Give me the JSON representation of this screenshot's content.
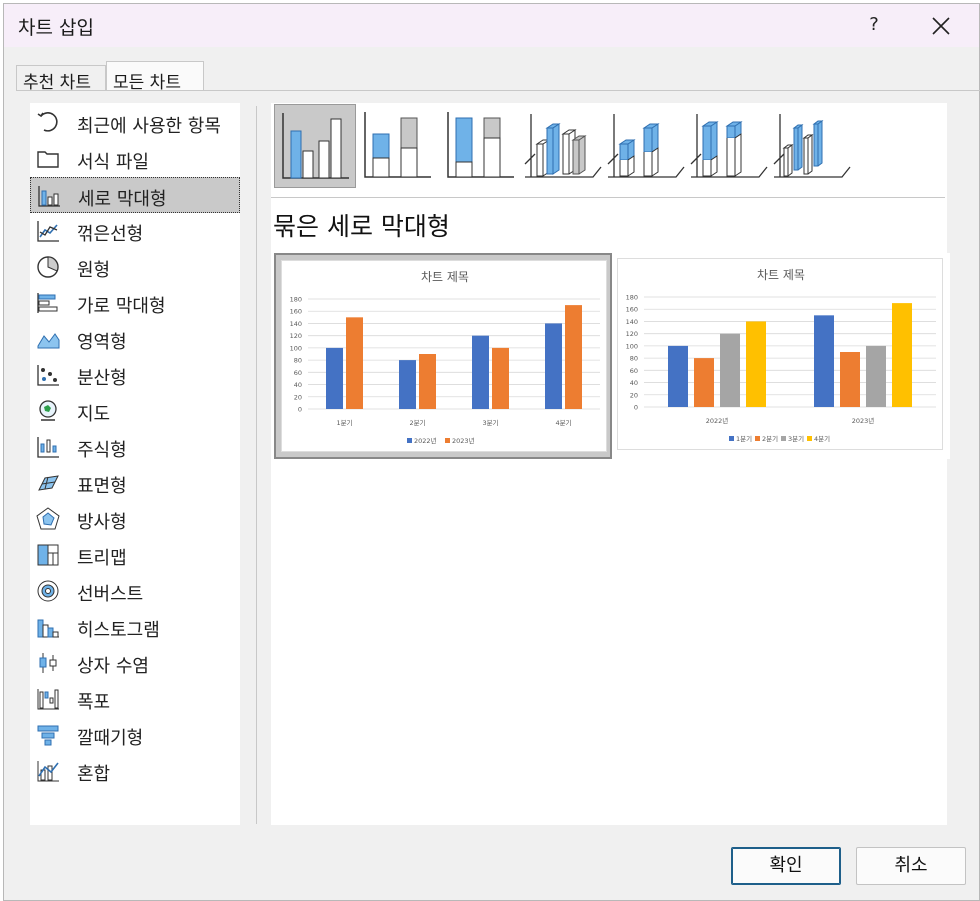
{
  "dialog": {
    "title": "차트 삽입",
    "help": "?",
    "tabs": [
      "추천 차트",
      "모든 차트"
    ]
  },
  "chart_types": [
    {
      "label": "최근에 사용한 항목",
      "icon": "recent-icon"
    },
    {
      "label": "서식 파일",
      "icon": "folder-icon"
    },
    {
      "label": "세로 막대형",
      "icon": "column-chart-icon",
      "selected": true
    },
    {
      "label": "꺾은선형",
      "icon": "line-chart-icon"
    },
    {
      "label": "원형",
      "icon": "pie-chart-icon"
    },
    {
      "label": "가로 막대형",
      "icon": "bar-chart-icon"
    },
    {
      "label": "영역형",
      "icon": "area-chart-icon"
    },
    {
      "label": "분산형",
      "icon": "scatter-chart-icon"
    },
    {
      "label": "지도",
      "icon": "map-chart-icon"
    },
    {
      "label": "주식형",
      "icon": "stock-chart-icon"
    },
    {
      "label": "표면형",
      "icon": "surface-chart-icon"
    },
    {
      "label": "방사형",
      "icon": "radar-chart-icon"
    },
    {
      "label": "트리맵",
      "icon": "treemap-icon"
    },
    {
      "label": "선버스트",
      "icon": "sunburst-icon"
    },
    {
      "label": "히스토그램",
      "icon": "histogram-icon"
    },
    {
      "label": "상자 수염",
      "icon": "box-whisker-icon"
    },
    {
      "label": "폭포",
      "icon": "waterfall-icon"
    },
    {
      "label": "깔때기형",
      "icon": "funnel-icon"
    },
    {
      "label": "혼합",
      "icon": "combo-chart-icon"
    }
  ],
  "subtype_title": "묶은 세로 막대형",
  "subtype_icons": [
    "clustered-column-icon",
    "stacked-column-icon",
    "percent-stacked-column-icon",
    "3d-clustered-column-icon",
    "3d-stacked-column-icon",
    "3d-percent-stacked-column-icon",
    "3d-column-icon"
  ],
  "colors": {
    "blue": "#4472c4",
    "orange": "#ed7d31",
    "gray": "#a5a5a5",
    "yellow": "#ffc000",
    "accent": "#1e5f8a"
  },
  "chart_data": [
    {
      "type": "bar",
      "title": "차트 제목",
      "categories": [
        "1분기",
        "2분기",
        "3분기",
        "4분기"
      ],
      "series": [
        {
          "name": "2022년",
          "values": [
            100,
            80,
            120,
            140
          ]
        },
        {
          "name": "2023년",
          "values": [
            150,
            90,
            100,
            170
          ]
        }
      ],
      "ylim": [
        0,
        180
      ],
      "yticks": [
        0,
        20,
        40,
        60,
        80,
        100,
        120,
        140,
        160,
        180
      ],
      "legend": "bottom"
    },
    {
      "type": "bar",
      "title": "차트 제목",
      "categories": [
        "2022년",
        "2023년"
      ],
      "series": [
        {
          "name": "1분기",
          "values": [
            100,
            150
          ]
        },
        {
          "name": "2분기",
          "values": [
            80,
            90
          ]
        },
        {
          "name": "3분기",
          "values": [
            120,
            100
          ]
        },
        {
          "name": "4분기",
          "values": [
            140,
            170
          ]
        }
      ],
      "ylim": [
        0,
        180
      ],
      "yticks": [
        0,
        20,
        40,
        60,
        80,
        100,
        120,
        140,
        160,
        180
      ],
      "legend": "bottom"
    }
  ],
  "buttons": {
    "ok": "확인",
    "cancel": "취소"
  }
}
